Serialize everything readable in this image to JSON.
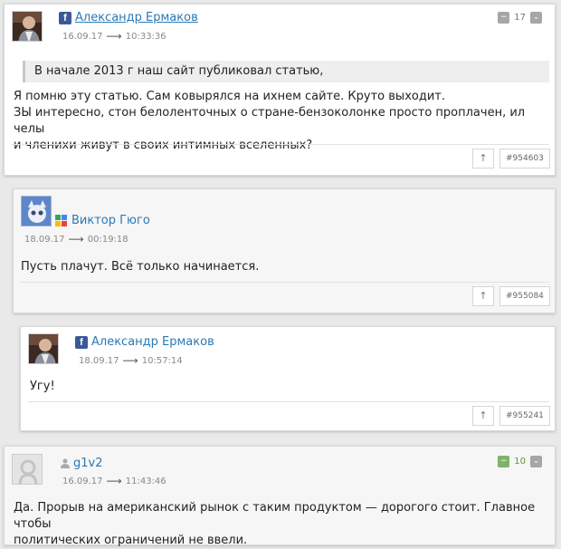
{
  "comments": [
    {
      "author": "Александр Ермаков",
      "date": "16.09.17",
      "time": "10:33:36",
      "rating": "17",
      "quote": "В начале 2013 г наш сайт публиковал статью,",
      "text_lines": [
        "Я помню эту статью. Сам ковырялся на ихнем сайте. Круто выходит.",
        "ЗЫ интересно, стон белоленточных о стране-бензоколонке просто проплачен, ил челы",
        "и членихи живут в своих интимных вселенных?"
      ],
      "up_label": "↑",
      "id_label": "#954603"
    },
    {
      "author": "Виктор Гюго",
      "date": "18.09.17",
      "time": "00:19:18",
      "text_lines": [
        "Пусть плачут. Всё только начинается."
      ],
      "up_label": "↑",
      "id_label": "#955084"
    },
    {
      "author": "Александр Ермаков",
      "date": "18.09.17",
      "time": "10:57:14",
      "text_lines": [
        "Угу!"
      ],
      "up_label": "↑",
      "id_label": "#955241"
    },
    {
      "author": "g1v2",
      "date": "16.09.17",
      "time": "11:43:46",
      "rating": "10",
      "text_lines": [
        "Да. Прорыв на американский рынок с таким продуктом — дорогого стоит. Главное чтобы",
        "политических ограничений не ввели."
      ]
    }
  ],
  "colors": {
    "link": "#2a79b6",
    "facebook": "#3b5998",
    "positive_score": "#5a9a3a"
  },
  "icons": [
    "facebook-icon",
    "google-plus-icon",
    "user-icon",
    "arrow-right-icon",
    "vote-minus-icon",
    "vote-plus-icon"
  ]
}
